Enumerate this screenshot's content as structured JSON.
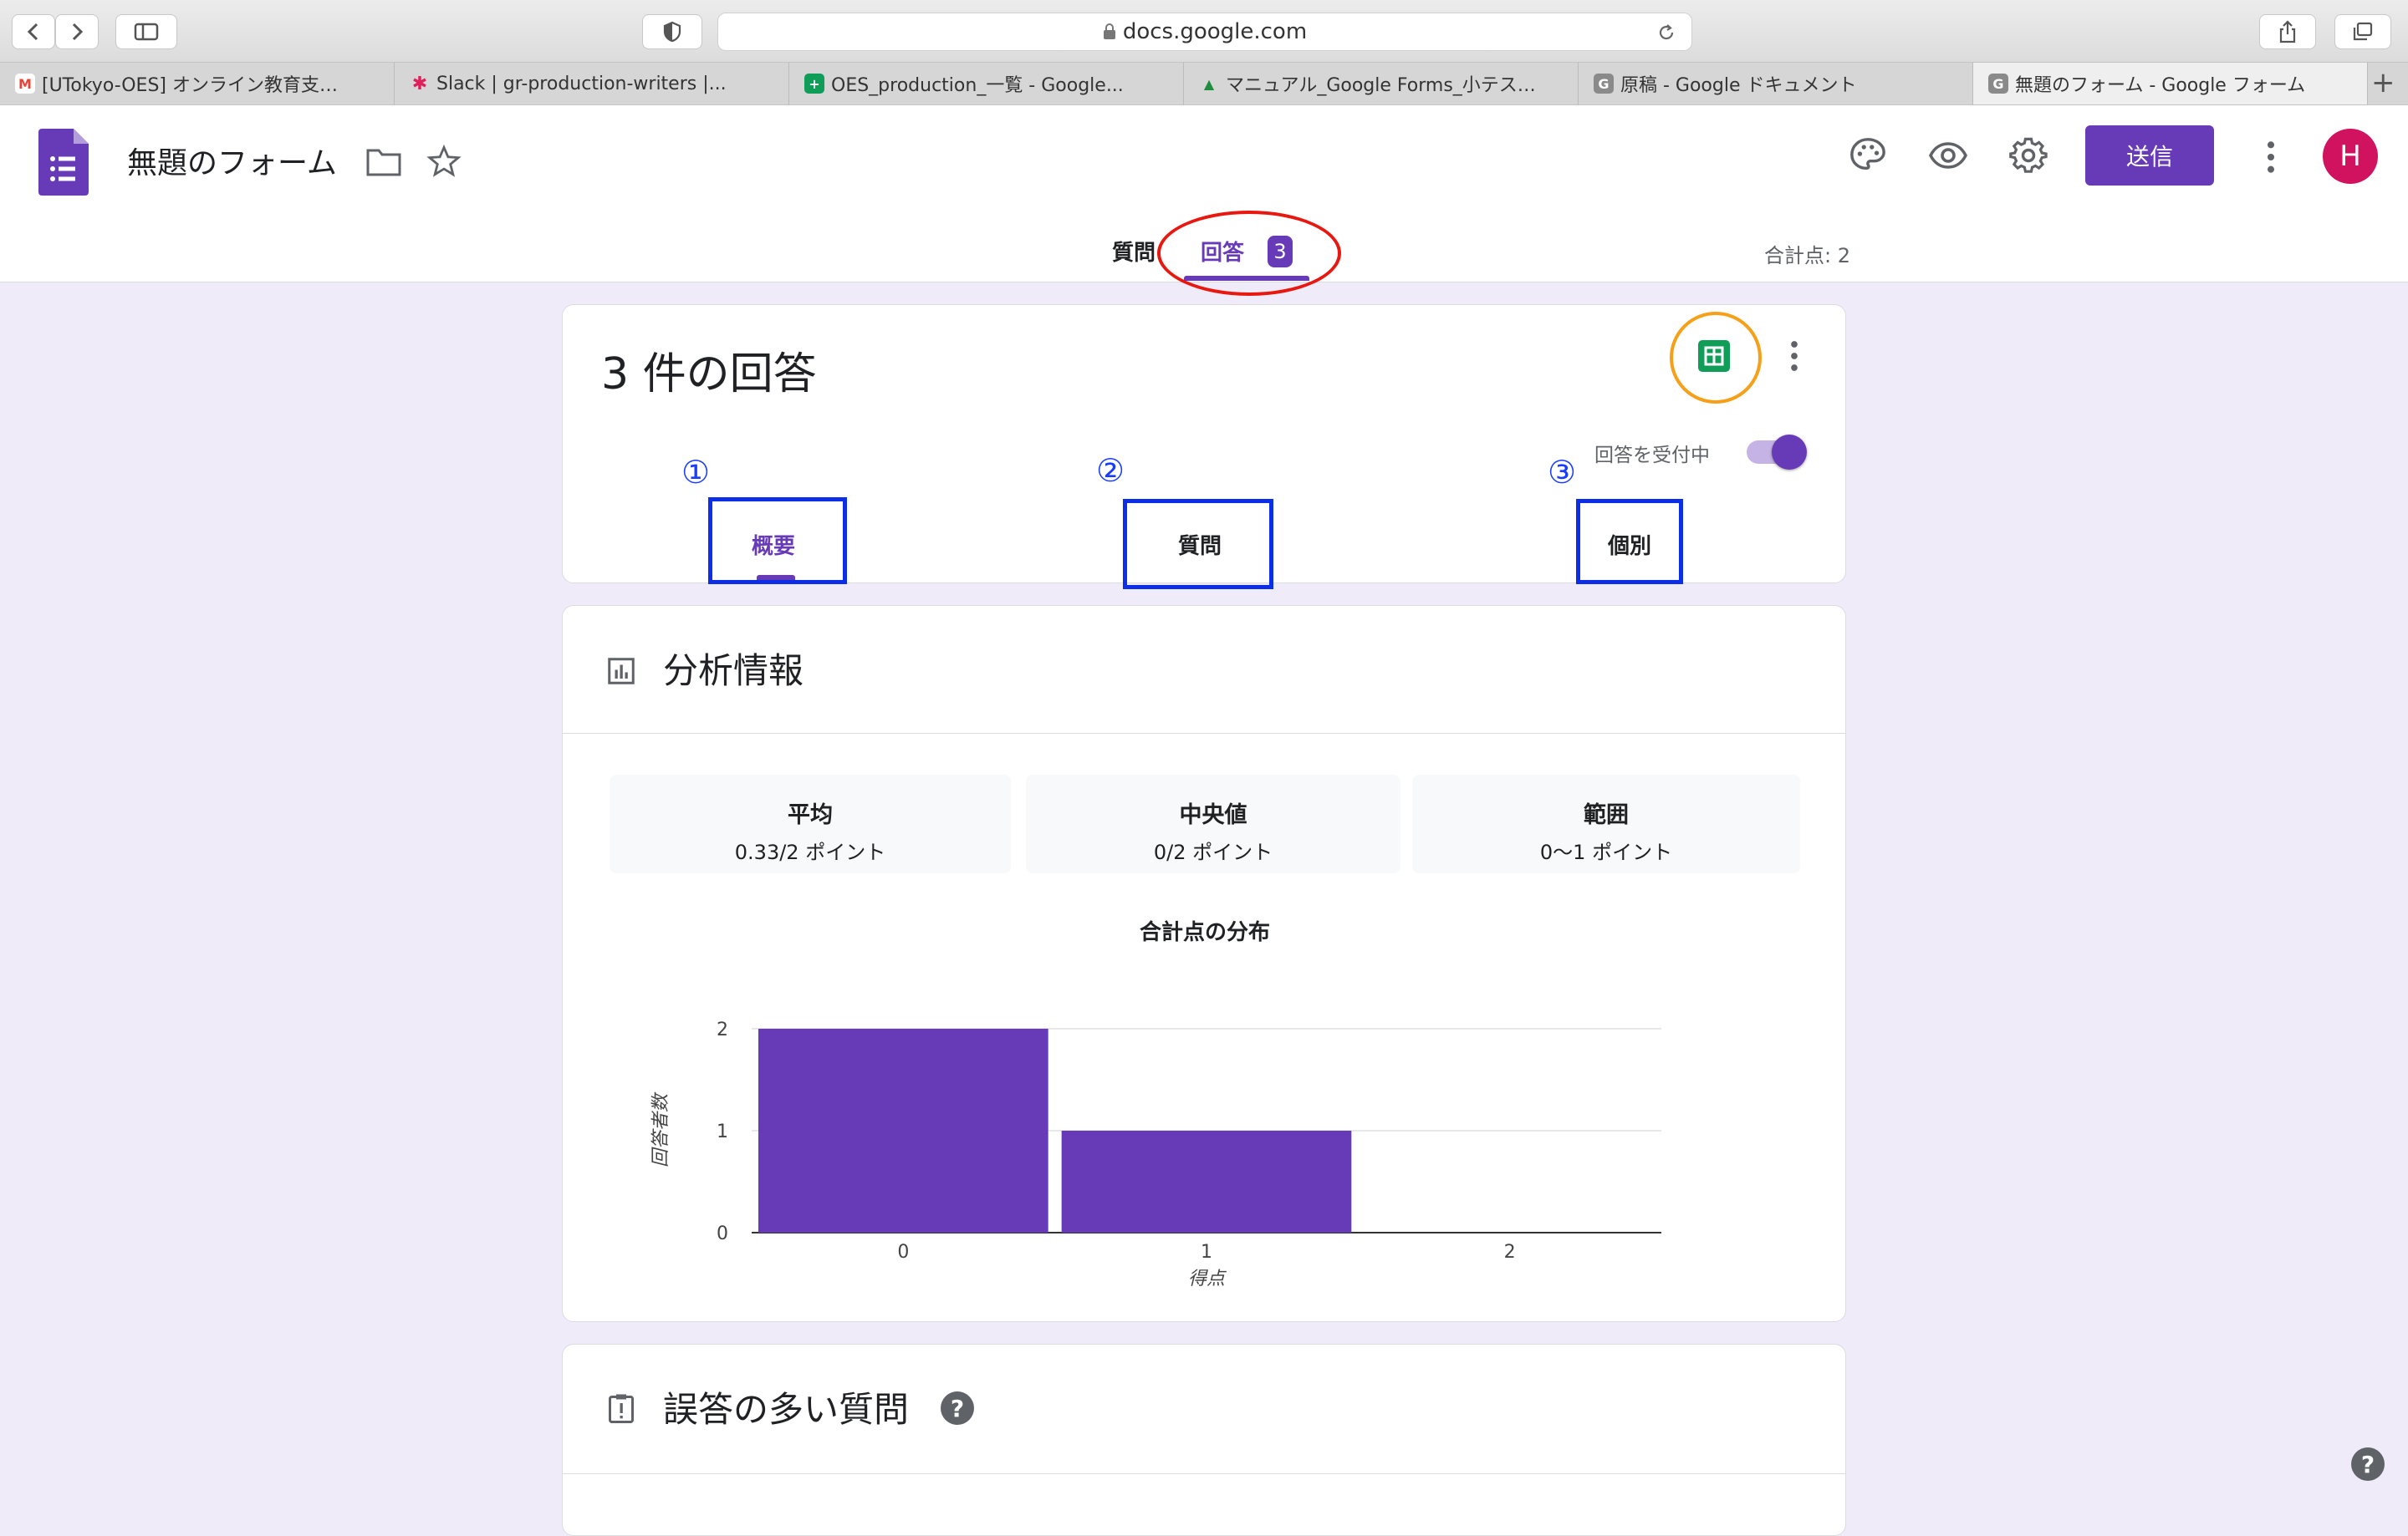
{
  "browser": {
    "url": "docs.google.com",
    "tabs": [
      {
        "label": "[UTokyo-OES] オンライン教育支…",
        "icon": "M",
        "icon_color": "#ea4335"
      },
      {
        "label": "Slack | gr-production-writers |...",
        "icon": "✱",
        "icon_color": "#e01e5a"
      },
      {
        "label": "OES_production_一覧 - Google...",
        "icon": "+",
        "icon_color": "#0f9d58"
      },
      {
        "label": "マニュアル_Google Forms_小テス…",
        "icon": "▲",
        "icon_color": "#fbbc04"
      },
      {
        "label": "原稿 - Google ドキュメント",
        "icon": "G",
        "icon_color": "#7a7a7a"
      },
      {
        "label": "無題のフォーム - Google フォーム",
        "icon": "G",
        "icon_color": "#7a7a7a"
      }
    ]
  },
  "header": {
    "form_title": "無題のフォーム",
    "send_label": "送信",
    "avatar_letter": "H",
    "tab_questions": "質問",
    "tab_responses": "回答",
    "responses_badge": "3",
    "total_points": "合計点: 2"
  },
  "summary_card": {
    "title": "3 件の回答",
    "accepting_label": "回答を受付中",
    "accepting": true,
    "subtabs": [
      {
        "num": "①",
        "label": "概要"
      },
      {
        "num": "②",
        "label": "質問"
      },
      {
        "num": "③",
        "label": "個別"
      }
    ]
  },
  "insights": {
    "title": "分析情報",
    "stats": [
      {
        "title": "平均",
        "value": "0.33/2 ポイント"
      },
      {
        "title": "中央値",
        "value": "0/2 ポイント"
      },
      {
        "title": "範囲",
        "value": "0〜1 ポイント"
      }
    ]
  },
  "chart_data": {
    "type": "bar",
    "title": "合計点の分布",
    "categories": [
      "0",
      "1",
      "2"
    ],
    "values": [
      2,
      1,
      0
    ],
    "xlabel": "得点",
    "ylabel": "回答者数",
    "ylim": [
      0,
      2
    ],
    "yticks": [
      "0",
      "1",
      "2"
    ],
    "color": "#673ab7",
    "grid": true
  },
  "frequently_missed": {
    "title": "誤答の多い質問"
  },
  "colors": {
    "accent": "#673ab7",
    "background": "#f0ebf8",
    "annotation_red": "#e8170f",
    "annotation_orange": "#f6a019",
    "annotation_blue": "#0b2ee6"
  }
}
